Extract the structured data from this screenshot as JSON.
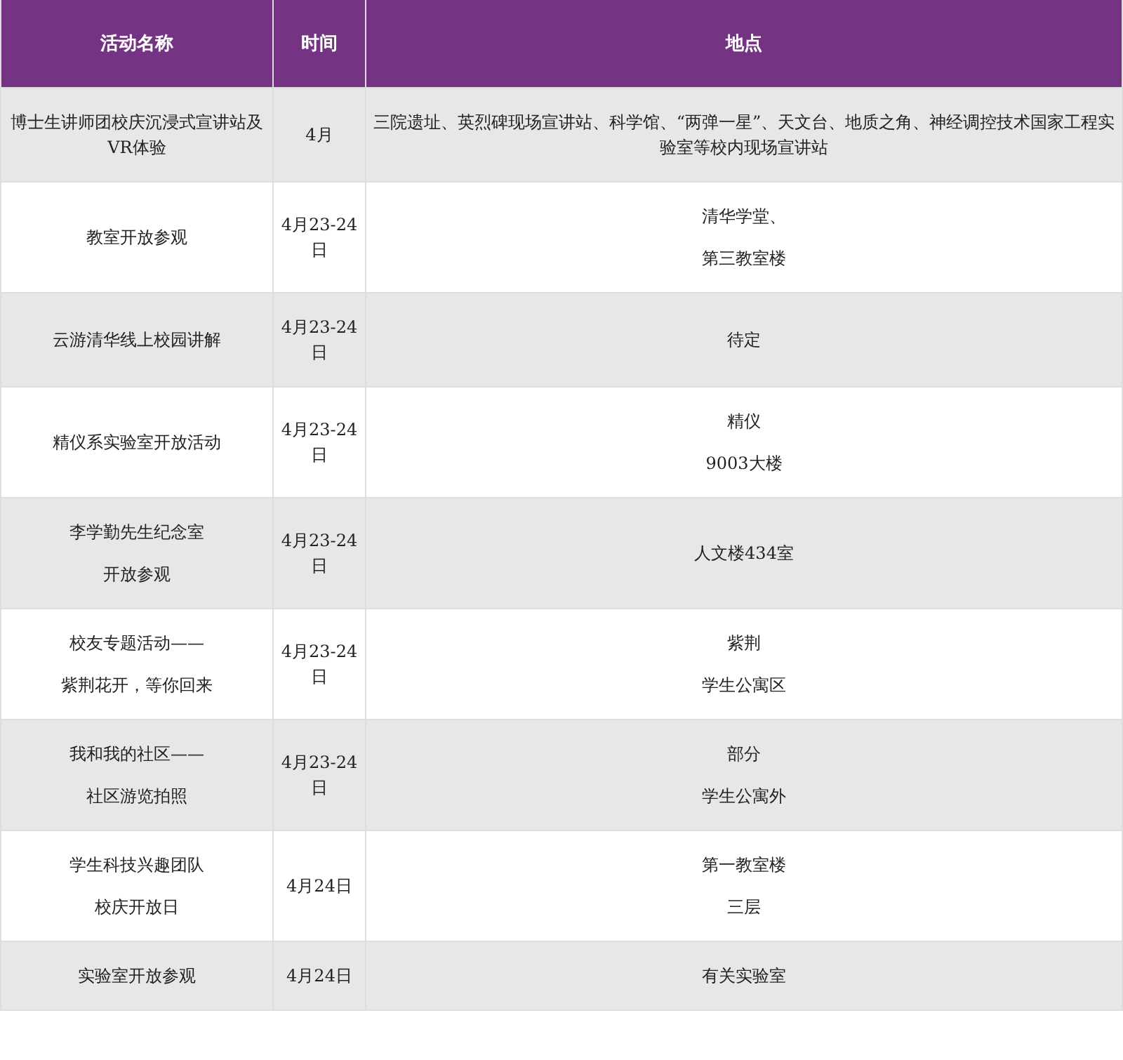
{
  "table": {
    "columns": [
      "活动名称",
      "时间",
      "地点"
    ],
    "rows": [
      [
        [
          "博士生讲师团校庆沉浸式宣讲站及VR体验"
        ],
        [
          "4月"
        ],
        [
          "三院遗址、英烈碑现场宣讲站、科学馆、“两弹一星”、天文台、地质之角、神经调控技术国家工程实验室等校内现场宣讲站"
        ]
      ],
      [
        [
          "教室开放参观"
        ],
        [
          "4月23-24日"
        ],
        [
          "清华学堂、",
          "第三教室楼"
        ]
      ],
      [
        [
          "云游清华线上校园讲解"
        ],
        [
          "4月23-24日"
        ],
        [
          "待定"
        ]
      ],
      [
        [
          "精仪系实验室开放活动"
        ],
        [
          "4月23-24日"
        ],
        [
          "精仪",
          "9003大楼"
        ]
      ],
      [
        [
          "李学勤先生纪念室",
          "开放参观"
        ],
        [
          "4月23-24日"
        ],
        [
          "人文楼434室"
        ]
      ],
      [
        [
          "校友专题活动——",
          "紫荆花开，等你回来"
        ],
        [
          "4月23-24日"
        ],
        [
          "紫荆",
          "学生公寓区"
        ]
      ],
      [
        [
          "我和我的社区——",
          "社区游览拍照"
        ],
        [
          "4月23-24日"
        ],
        [
          "部分",
          "学生公寓外"
        ]
      ],
      [
        [
          "学生科技兴趣团队",
          "校庆开放日"
        ],
        [
          "4月24日"
        ],
        [
          "第一教室楼",
          "三层"
        ]
      ],
      [
        [
          "实验室开放参观"
        ],
        [
          "4月24日"
        ],
        [
          "有关实验室"
        ]
      ]
    ]
  }
}
